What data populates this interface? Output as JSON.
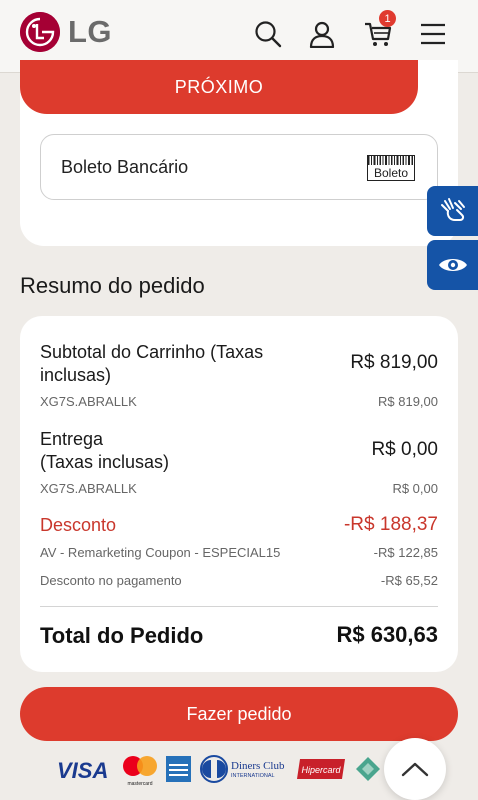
{
  "header": {
    "logo_text": "LG",
    "cart_count": "1"
  },
  "payment": {
    "next_label": "PRÓXIMO",
    "method_label": "Boleto Bancário",
    "method_logo_text": "Boleto"
  },
  "summary": {
    "title": "Resumo do pedido",
    "subtotal": {
      "label_line1": "Subtotal do Carrinho (Taxas",
      "label_line2": "inclusas)",
      "value": "R$ 819,00",
      "sku": "XG7S.ABRALLK",
      "sku_value": "R$ 819,00"
    },
    "shipping": {
      "label_line1": "Entrega",
      "label_line2": "(Taxas inclusas)",
      "value": "R$ 0,00",
      "sku": "XG7S.ABRALLK",
      "sku_value": "R$ 0,00"
    },
    "discount": {
      "label": "Desconto",
      "value": "-R$ 188,37",
      "items": [
        {
          "label": "AV - Remarketing Coupon - ESPECIAL15",
          "value": "-R$ 122,85"
        },
        {
          "label": "Desconto no pagamento",
          "value": "-R$ 65,52"
        }
      ]
    },
    "total": {
      "label": "Total do Pedido",
      "value": "R$ 630,63"
    }
  },
  "place_order_label": "Fazer pedido",
  "payment_logos": {
    "visa": "VISA",
    "mastercard": "mastercard",
    "diners_line1": "Diners Club",
    "diners_line2": "INTERNATIONAL",
    "hipercard": "Hipercard"
  },
  "colors": {
    "brand_red": "#dd3b2d",
    "lg_red": "#a50034",
    "accessibility_blue": "#1554a7",
    "discount_red": "#c9372c"
  },
  "icons": [
    "lg-logo-icon",
    "search-icon",
    "user-icon",
    "cart-icon",
    "menu-icon",
    "sign-language-icon",
    "eye-icon",
    "chevron-up-icon"
  ]
}
